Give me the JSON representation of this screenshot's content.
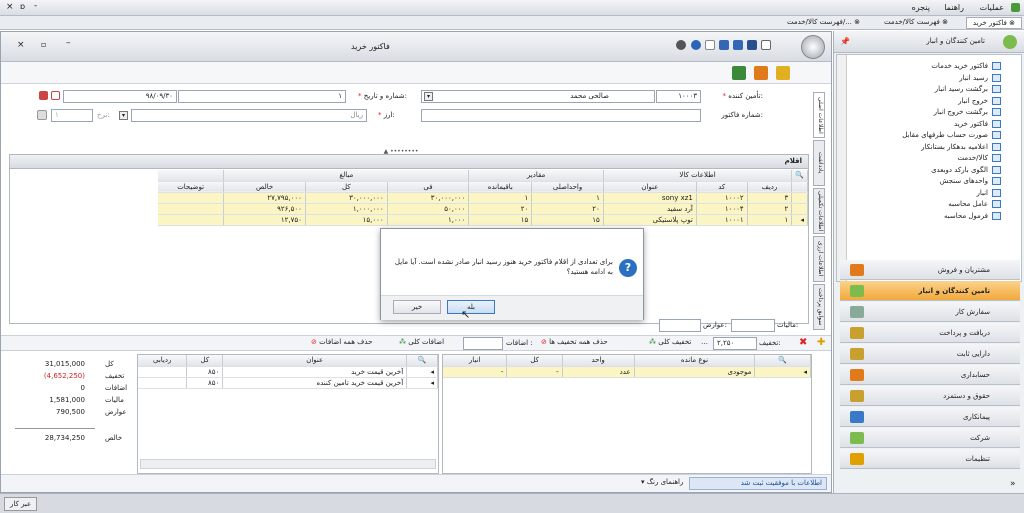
{
  "menu": {
    "items": [
      "عملیات",
      "راهنما",
      "پنجره"
    ],
    "window_controls": [
      "-",
      "ɒ",
      "×"
    ]
  },
  "tabs": [
    {
      "label": "فاکتور خرید"
    },
    {
      "label": "فهرست کالا/خدمت"
    },
    {
      "label": "فهرست کالا/خدمت/..."
    }
  ],
  "nav": {
    "title": "تامین کنندگان و انبار",
    "tree_items": [
      "فاکتور خرید خدمات",
      "رسید انبار",
      "برگشت رسید انبار",
      "خروج انبار",
      "برگشت خروج انبار",
      "فاکتور خرید",
      "صورت حساب طرفهای مقابل",
      "اعلامیه بدهکار بستانکار",
      "کالا/خدمت",
      "الگوی بارکد دوبعدی",
      "واحدهای سنجش",
      "انبار",
      "عامل محاسبه",
      "فرمول محاسبه"
    ],
    "sections": [
      "مشتریان و فروش",
      "تامین کنندگان و انبار",
      "سفارش کار",
      "دریافت و پرداخت",
      "دارایی ثابت",
      "حسابداری",
      "حقوق و دستمزد",
      "پیمانکاری",
      "شرکت",
      "تنظیمات"
    ]
  },
  "form": {
    "title": "فاکتور خرید",
    "supplier_label": "تأمین کننده:",
    "supplier_code": "۱۰۰۰۳",
    "supplier_name": "صالحی محمد",
    "number_date_label": "شماره و تاریخ:",
    "number": "۱",
    "date": "۹۸/۰۹/۳۰",
    "invoice_no_label": "شماره فاکتور:",
    "currency_label": "ارز:",
    "currency_value": "ریال",
    "rate_label": "نرخ:",
    "rate_value": "۱"
  },
  "vtabs": [
    "اطلاعات اصلی",
    "یادداشت",
    "اطلاعات تکمیلی",
    "اطلاعات ارزی",
    "سوابق پرداخت"
  ],
  "items_grid": {
    "title": "اقلام",
    "group_headers": {
      "goods": "اطلاعات کالا",
      "amounts": "مقادیر",
      "prices": "مبالغ"
    },
    "columns": [
      "ردیف",
      "کد",
      "عنوان",
      "واحداصلی",
      "باقیمانده",
      "فی",
      "کل",
      "خالص",
      "توضیحات"
    ],
    "rows": [
      [
        "۳",
        "۱۰۰۰۲",
        "sony xz1",
        "۱",
        "۱",
        "۳۰,۰۰۰,۰۰۰",
        "۳۰,۰۰۰,۰۰۰",
        "۲۷,۷۹۵,۰۰۰",
        ""
      ],
      [
        "۲",
        "۱۰۰۰۴",
        "آرد سفید",
        "۲۰",
        "۲۰",
        "۵۰,۰۰۰",
        "۱,۰۰۰,۰۰۰",
        "۹۲۶,۵۰۰",
        ""
      ],
      [
        "۱",
        "۱۰۰۰۱",
        "توپ پلاستیکی",
        "۱۵",
        "۱۵",
        "۱,۰۰۰",
        "۱۵,۰۰۰",
        "۱۲,۷۵۰",
        ""
      ]
    ]
  },
  "dialog": {
    "message": "برای تعدادی از اقلام فاکتور خرید هنوز رسید انبار صادر نشده است. آیا مایل به ادامه هستید؟",
    "yes": "بله",
    "no": "خیر"
  },
  "footer_bar": {
    "tax_label": "مالیات:",
    "tolls_label": "عوارض:",
    "discount_label": "تخفیف:",
    "discount_value": "۲,۲۵۰",
    "global_discount": "تخفیف کلی",
    "remove_all_discounts": "حذف همه تخفیف ها",
    "additions_label": "اضافات :",
    "global_additions": "اضافات کلی",
    "remove_all_additions": "حذف همه اضافات"
  },
  "bottom_left": {
    "columns": [
      "نوع مانده",
      "واحد",
      "کل",
      "انبار"
    ],
    "row": [
      "موجودی",
      "عدد",
      "-",
      "-"
    ]
  },
  "bottom_mid": {
    "columns": [
      "عنوان",
      "کل",
      "ردیابی"
    ],
    "rows": [
      [
        "آخرین قیمت خرید",
        "۸۵۰",
        ""
      ],
      [
        "آخرین قیمت خرید تامین کننده",
        "۸۵۰",
        ""
      ]
    ]
  },
  "totals": {
    "rows": [
      {
        "label": "کل",
        "value": "31,015,000"
      },
      {
        "label": "تخفیف",
        "value": "(4,652,250)"
      },
      {
        "label": "اضافات",
        "value": "0"
      },
      {
        "label": "مالیات",
        "value": "1,581,000"
      },
      {
        "label": "عوارض",
        "value": "790,500"
      },
      {
        "label": "خالص",
        "value": "28,734,250"
      }
    ]
  },
  "status": {
    "message": "اطلاعات با موفقیت ثبت شد",
    "color_guide": "راهنمای رنگ",
    "bottom_button": "عبر کار"
  },
  "colors": {
    "accent": "#3a78c8",
    "highlight_row": "#fbf4c3",
    "negative": "#d22222"
  }
}
